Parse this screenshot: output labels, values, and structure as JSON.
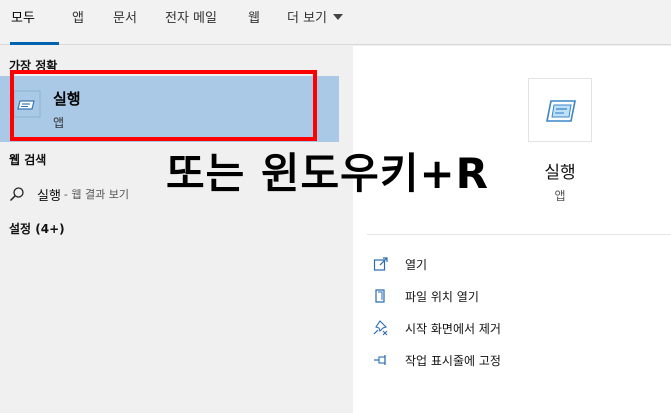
{
  "tabs": [
    {
      "label": "모두"
    },
    {
      "label": "앱"
    },
    {
      "label": "문서"
    },
    {
      "label": "전자 메일"
    },
    {
      "label": "웹"
    },
    {
      "label": "더 보기"
    }
  ],
  "left": {
    "best_match_heading": "가장 정확",
    "best_match": {
      "title": "실행",
      "subtitle": "앱"
    },
    "web_heading": "웹 검색",
    "web_result": {
      "query": "실행",
      "hint": "- 웹 결과 보기"
    },
    "settings_heading": "설정 (4+)"
  },
  "right": {
    "title": "실행",
    "subtitle": "앱",
    "actions": [
      {
        "label": "열기",
        "icon": "open-icon"
      },
      {
        "label": "파일 위치 열기",
        "icon": "file-location-icon"
      },
      {
        "label": "시작 화면에서 제거",
        "icon": "unpin-start-icon"
      },
      {
        "label": "작업 표시줄에 고정",
        "icon": "pin-taskbar-icon"
      }
    ]
  },
  "overlay_text": "또는 윈도우키+R",
  "colors": {
    "accent": "#0063b1",
    "selection": "#a9c9e6",
    "highlight_box": "#ff0000"
  }
}
